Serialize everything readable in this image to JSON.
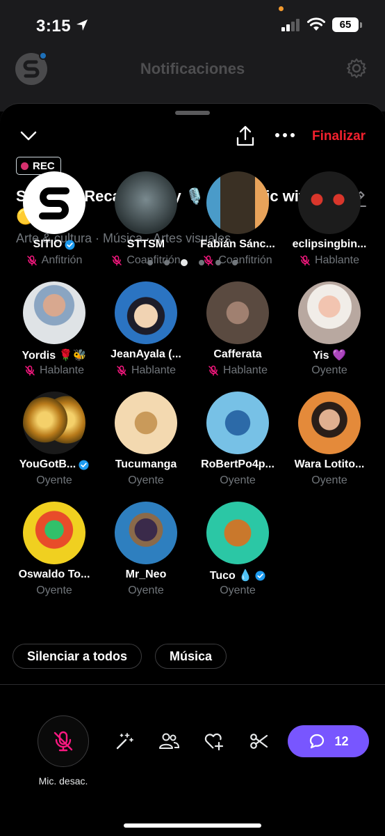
{
  "status_bar": {
    "time": "3:15",
    "battery": "65"
  },
  "app_header": {
    "title": "Notificaciones"
  },
  "space": {
    "finalize_label": "Finalizar",
    "rec_label": "REC",
    "title": "SITIO: 🎊Recap 2024 y 🎙️ Open mic with (🟡,🟡)",
    "topics": "Arte & cultura · Música · Artes visuales",
    "page_count": 6,
    "active_page": 3
  },
  "participants": [
    {
      "name": "SITIO",
      "role": "Anfitrión",
      "verified": true,
      "muted": true
    },
    {
      "name": "STTSM",
      "role": "Coanfitrión",
      "verified": false,
      "muted": true
    },
    {
      "name": "Fabián Sánc...",
      "role": "Coanfitrión",
      "verified": false,
      "muted": true
    },
    {
      "name": "eclipsingbin...",
      "role": "Hablante",
      "verified": false,
      "muted": true
    },
    {
      "name": "Yordis 🌹🐝",
      "role": "Hablante",
      "verified": false,
      "muted": true
    },
    {
      "name": "JeanAyala (...",
      "role": "Hablante",
      "verified": false,
      "muted": true
    },
    {
      "name": "Cafferata",
      "role": "Hablante",
      "verified": false,
      "muted": true
    },
    {
      "name": "Yis 💜",
      "role": "Oyente",
      "verified": false,
      "muted": false
    },
    {
      "name": "YouGotB...",
      "role": "Oyente",
      "verified": true,
      "muted": false
    },
    {
      "name": "Tucumanga",
      "role": "Oyente",
      "verified": false,
      "muted": false
    },
    {
      "name": "RoBertPo4p...",
      "role": "Oyente",
      "verified": false,
      "muted": false
    },
    {
      "name": "Wara Lotito...",
      "role": "Oyente",
      "verified": false,
      "muted": false
    },
    {
      "name": "Oswaldo To...",
      "role": "Oyente",
      "verified": false,
      "muted": false
    },
    {
      "name": "Mr_Neo",
      "role": "Oyente",
      "verified": false,
      "muted": false
    },
    {
      "name": "Tuco 💧",
      "role": "Oyente",
      "verified": true,
      "muted": false
    }
  ],
  "chips": {
    "mute_all": "Silenciar a todos",
    "music": "Música"
  },
  "bottom_bar": {
    "mic_label": "Mic. desac.",
    "comment_count": "12"
  },
  "colors": {
    "accent_red": "#f4212e",
    "accent_purple": "#7856ff",
    "verified_blue": "#1d9bf0",
    "muted_pink": "#f91880",
    "rec_dot": "#d6306e"
  }
}
